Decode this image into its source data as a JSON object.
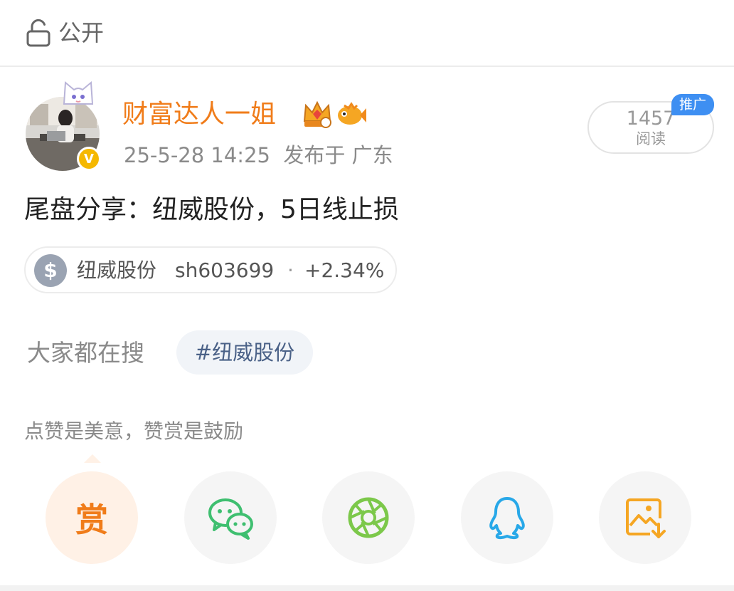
{
  "header": {
    "visibility_label": "公开",
    "lock_icon": "lock-open-icon"
  },
  "author": {
    "name": "财富达人一姐",
    "verified_badge": "V",
    "badges": [
      "crown-icon",
      "fish-icon"
    ],
    "timestamp": "25-5-28 14:25",
    "location_text": "发布于 广东",
    "accent_color": "#f07c1a"
  },
  "read_stats": {
    "count": "1457",
    "label": "阅读",
    "promo_tag": "推广",
    "promo_color": "#3e8ff2"
  },
  "post": {
    "text": "尾盘分享：纽威股份，5日线止损"
  },
  "stock_card": {
    "icon": "$",
    "name": "纽威股份",
    "code": "sh603699",
    "separator": "·",
    "change": "+2.34%"
  },
  "hot_search": {
    "label": "大家都在搜",
    "tag": "#纽威股份"
  },
  "reward": {
    "prompt": "点赞是美意，赞赏是鼓励"
  },
  "share_actions": [
    {
      "name": "reward",
      "label": "赏",
      "icon": "reward-icon",
      "color": "#f07c1a"
    },
    {
      "name": "wechat",
      "icon": "wechat-icon",
      "color": "#3fbf70"
    },
    {
      "name": "moments",
      "icon": "moments-aperture-icon",
      "color": "#7cc84a"
    },
    {
      "name": "qq",
      "icon": "qq-penguin-icon",
      "color": "#28a8e8"
    },
    {
      "name": "save-image",
      "icon": "save-image-icon",
      "color": "#f5a623"
    }
  ]
}
